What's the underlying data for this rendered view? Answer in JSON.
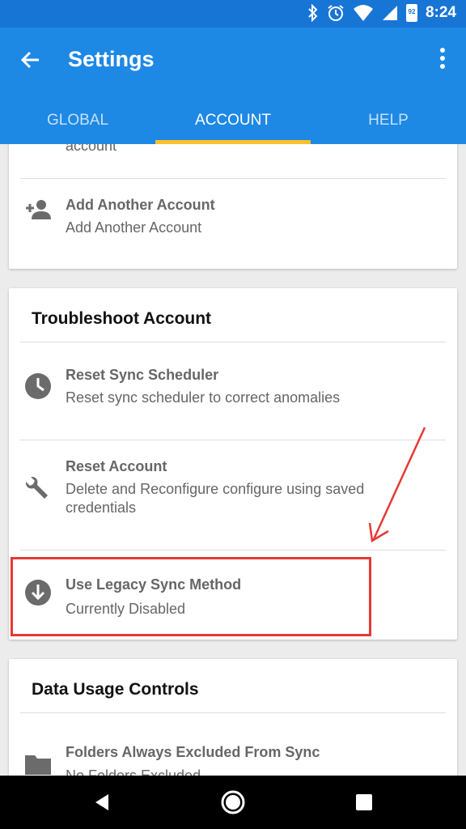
{
  "status_bar": {
    "time": "8:24",
    "battery_level": "92",
    "icons": [
      "bluetooth-icon",
      "alarm-icon",
      "wifi-icon",
      "signal-icon",
      "battery-icon"
    ]
  },
  "app_bar": {
    "title": "Settings",
    "tabs": [
      {
        "label": "GLOBAL",
        "active": false
      },
      {
        "label": "ACCOUNT",
        "active": true
      },
      {
        "label": "HELP",
        "active": false
      }
    ]
  },
  "accounts_card": {
    "partial_text": "account",
    "rows": [
      {
        "title": "Add Another Account",
        "subtitle": "Add Another Account",
        "icon": "add-person-icon"
      }
    ]
  },
  "troubleshoot_card": {
    "title": "Troubleshoot Account",
    "rows": [
      {
        "title": "Reset Sync Scheduler",
        "subtitle": "Reset sync scheduler to correct anomalies",
        "icon": "clock-icon"
      },
      {
        "title": "Reset Account",
        "subtitle": "Delete and Reconfigure configure using saved credentials",
        "icon": "wrench-icon"
      },
      {
        "title": "Use Legacy Sync Method",
        "subtitle": "Currently Disabled",
        "icon": "download-circle-icon"
      }
    ]
  },
  "data_usage_card": {
    "title": "Data Usage Controls",
    "rows": [
      {
        "title": "Folders Always Excluded From Sync",
        "subtitle": "No Folders Excluded",
        "icon": "folder-icon"
      }
    ]
  },
  "colors": {
    "status_bar": "#1775d6",
    "app_bar": "#1e88e5",
    "tab_indicator": "#fbc02d",
    "annotation": "#e53935"
  }
}
